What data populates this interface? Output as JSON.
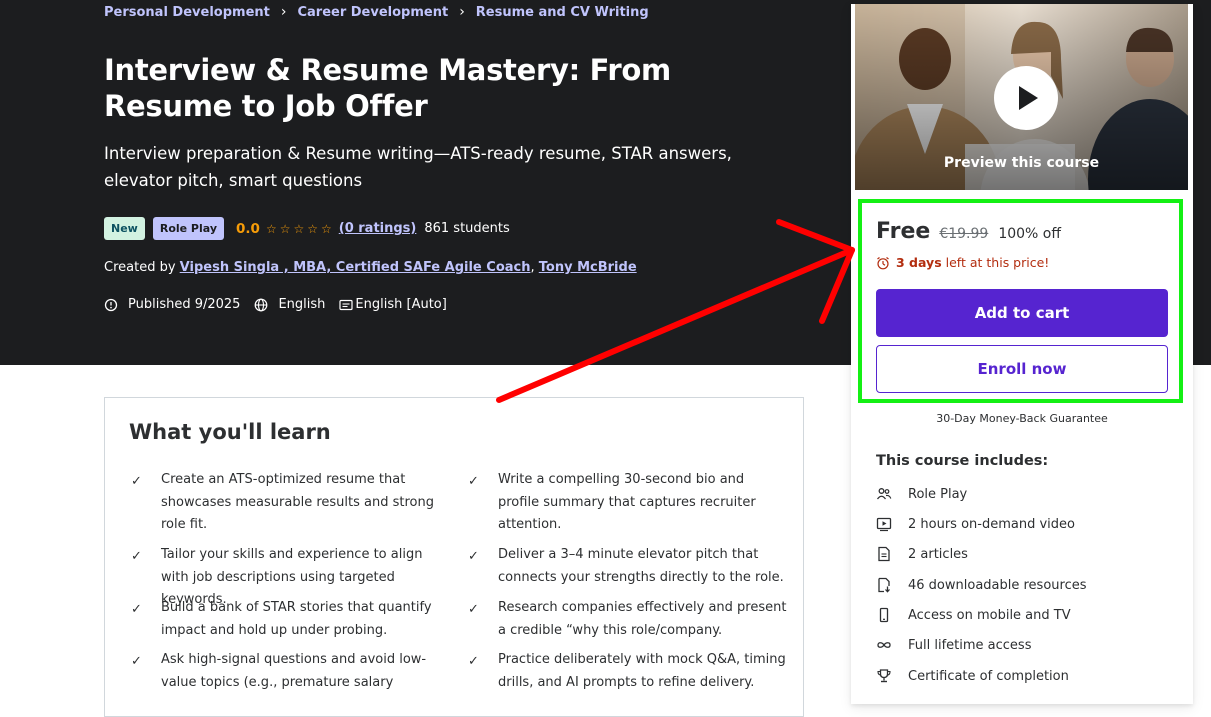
{
  "breadcrumbs": [
    "Personal Development",
    "Career Development",
    "Resume and CV Writing"
  ],
  "course": {
    "title": "Interview & Resume Mastery: From Resume to Job Offer",
    "subtitle": "Interview preparation & Resume writing—ATS-ready resume, STAR answers, elevator pitch, smart questions",
    "badge_new": "New",
    "badge_role_play": "Role Play",
    "rating": "0.0",
    "ratings_link": "(0 ratings)",
    "students": "861 students",
    "created_by_label": "Created by",
    "instructor_1": "Vipesh Singla , MBA, Certified SAFe Agile Coach",
    "instructor_sep": ",",
    "instructor_2": "Tony McBride",
    "published": "Published 9/2025",
    "language": "English",
    "captions": "English [Auto]"
  },
  "learn": {
    "title": "What you'll learn",
    "items": [
      "Create an ATS-optimized resume that showcases measurable results and strong role fit.",
      "Write a compelling 30-second bio and profile summary that captures recruiter attention.",
      "Tailor your skills and experience to align with job descriptions using targeted keywords.",
      "Deliver a 3–4 minute elevator pitch that connects your strengths directly to the role.",
      "Build a bank of STAR stories that quantify impact and hold up under probing.",
      "Research companies effectively and present a credible “why this role/company.",
      "Ask high-signal questions and avoid low-value topics (e.g., premature salary",
      "Practice deliberately with mock Q&A, timing drills, and AI prompts to refine delivery."
    ]
  },
  "sidebar": {
    "preview_label": "Preview this course",
    "price": "Free",
    "original_price": "€19.99",
    "discount": "100% off",
    "days_left": "3 days",
    "days_left_suffix": "left at this price!",
    "add_to_cart": "Add to cart",
    "enroll_now": "Enroll now",
    "guarantee": "30-Day Money-Back Guarantee",
    "includes_title": "This course includes:",
    "includes": [
      {
        "label": "Role Play",
        "icon": "role-play-icon"
      },
      {
        "label": "2 hours on-demand video",
        "icon": "video-icon"
      },
      {
        "label": "2 articles",
        "icon": "article-icon"
      },
      {
        "label": "46 downloadable resources",
        "icon": "download-icon"
      },
      {
        "label": "Access on mobile and TV",
        "icon": "mobile-icon"
      },
      {
        "label": "Full lifetime access",
        "icon": "infinity-icon"
      },
      {
        "label": "Certificate of completion",
        "icon": "trophy-icon"
      }
    ]
  },
  "colors": {
    "hero_bg": "#1c1d1f",
    "link": "#c0c4fc",
    "star": "#f69c08",
    "primary_button": "#5624d0",
    "urgency": "#b32d0f",
    "highlight_box": "#14f014",
    "annotation_arrow": "#ff0000"
  }
}
